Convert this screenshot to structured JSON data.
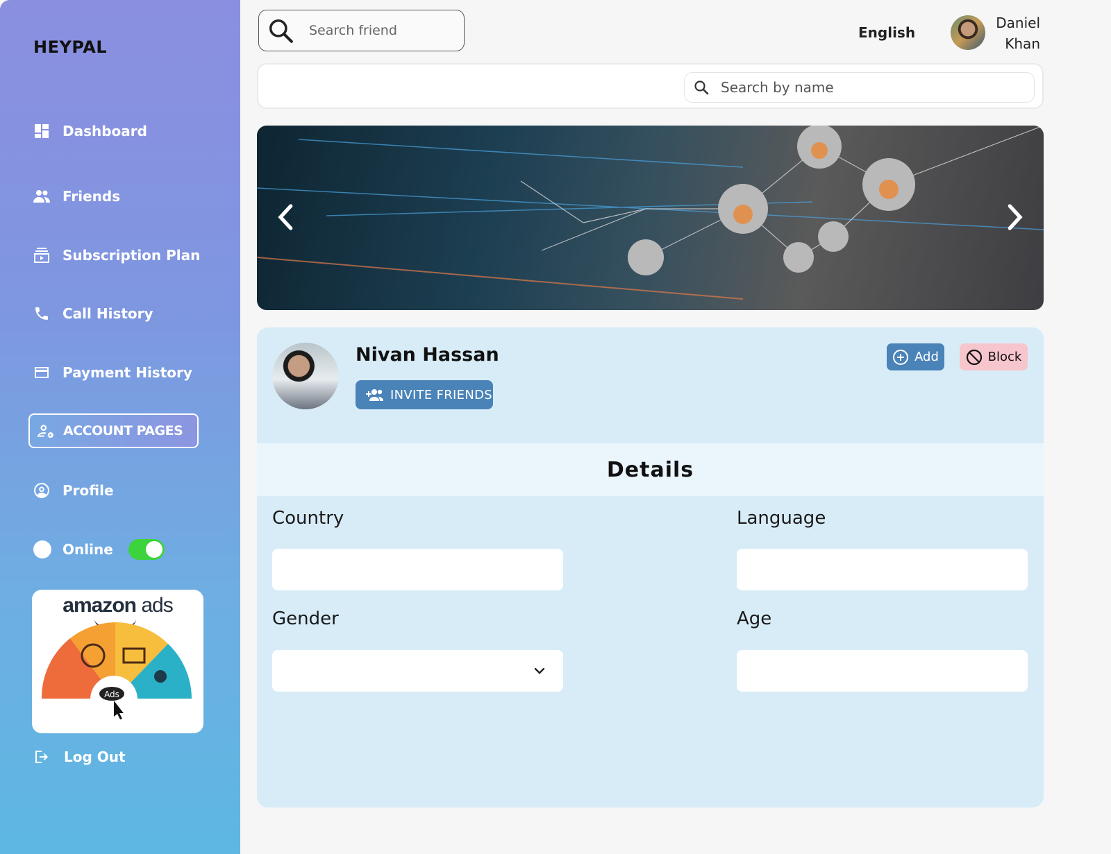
{
  "brand": "HEYPAL",
  "sidebar": {
    "items": [
      {
        "label": "Dashboard",
        "icon": "dashboard-icon"
      },
      {
        "label": "Friends",
        "icon": "friends-icon"
      },
      {
        "label": "Subscription Plan",
        "icon": "subscription-icon"
      },
      {
        "label": "Call History",
        "icon": "phone-icon"
      },
      {
        "label": "Payment History",
        "icon": "credit-card-icon"
      },
      {
        "label": "ACCOUNT PAGES",
        "icon": "account-icon",
        "active": true
      },
      {
        "label": "Profile",
        "icon": "profile-icon"
      }
    ],
    "online": {
      "label": "Online",
      "enabled": true
    },
    "ad": {
      "brand_word": "amazon",
      "product_word": "ads",
      "badge": "Ads"
    },
    "logout": "Log Out"
  },
  "topbar": {
    "friend_search_placeholder": "Search friend",
    "language": "English",
    "user_first": "Daniel",
    "user_last": "Khan"
  },
  "name_search_placeholder": "Search by name",
  "profile": {
    "name": "Nivan Hassan",
    "invite_label": "INVITE FRIENDS",
    "add_label": "Add",
    "block_label": "Block",
    "details_title": "Details",
    "fields": {
      "country": "Country",
      "language": "Language",
      "gender": "Gender",
      "age": "Age"
    }
  },
  "colors": {
    "accent": "#4a83b8",
    "block": "#f7c6cc",
    "card": "#d8ecf8",
    "toggle_on": "#3cd33c"
  }
}
